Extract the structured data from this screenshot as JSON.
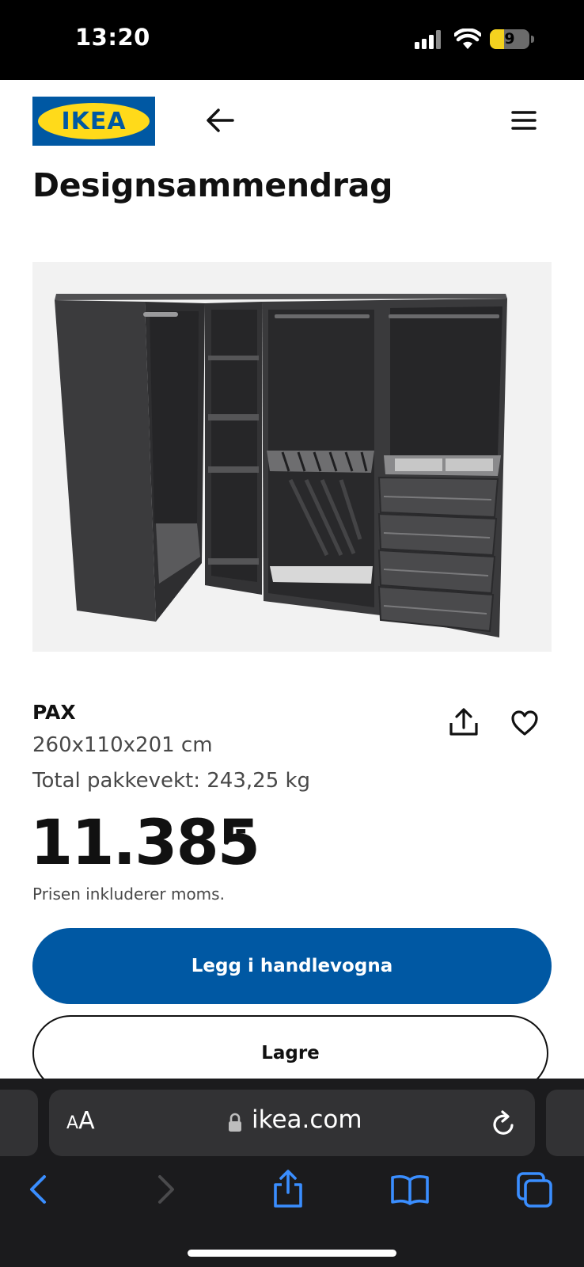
{
  "status_bar": {
    "time": "13:20",
    "battery_level": "9"
  },
  "header": {
    "logo_text": "IKEA",
    "logo_colors": {
      "blue": "#0058a3",
      "yellow": "#ffda1a"
    }
  },
  "page": {
    "title": "Designsammendrag"
  },
  "product": {
    "name": "PAX",
    "dimensions": "260x110x201 cm",
    "weight": "Total pakkevekt: 243,25 kg",
    "price": "11.385",
    "price_suffix": ",-",
    "vat_note": "Prisen inkluderer moms.",
    "image": "dark-grey-pax-corner-wardrobe"
  },
  "actions": {
    "add_to_cart": "Legg i handlevogna",
    "save": "Lagre"
  },
  "browser": {
    "text_size_small": "A",
    "text_size_big": "A",
    "url": "ikea.com"
  },
  "colors": {
    "primary": "#0058a3",
    "text": "#111111",
    "secondary_text": "#484848",
    "browser_accent": "#3a8eff"
  }
}
